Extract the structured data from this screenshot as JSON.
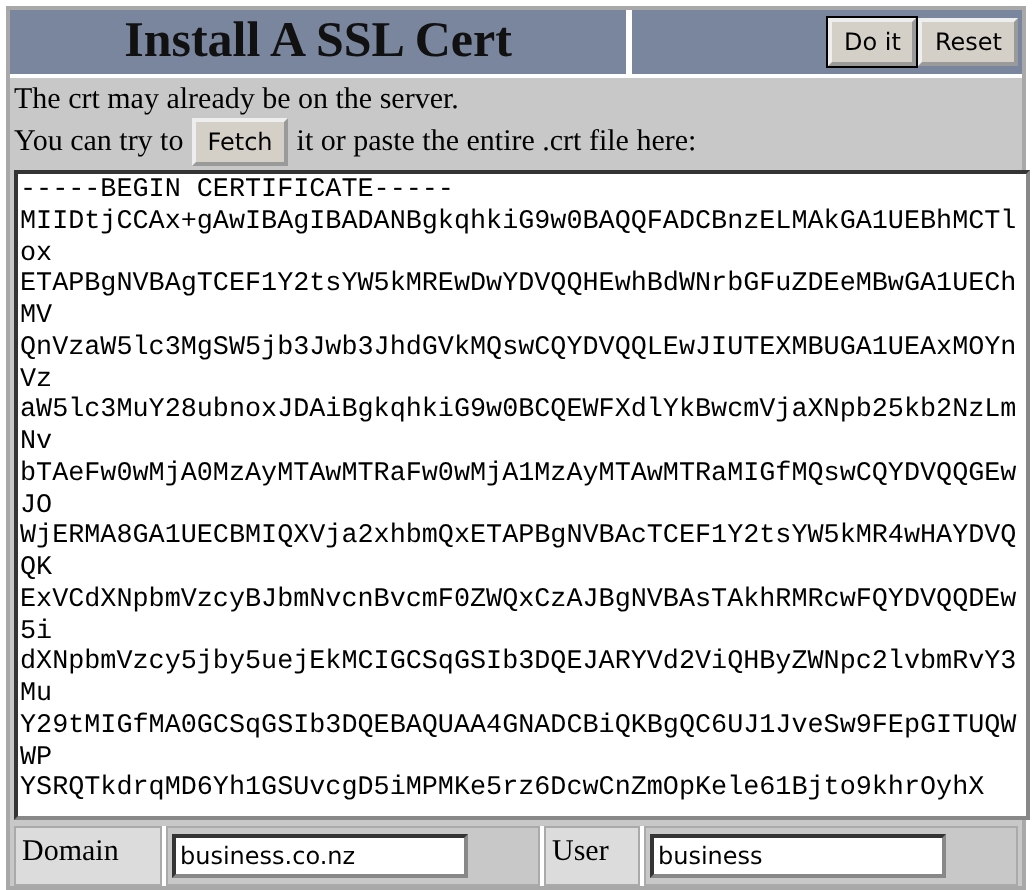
{
  "header": {
    "title": "Install A SSL Cert",
    "buttons": [
      "Do it",
      "Reset"
    ]
  },
  "intro": "The crt may already be on the server.",
  "fetch_line": {
    "before": "You can try to",
    "button": "Fetch",
    "after": "it or paste the entire .crt file here:"
  },
  "certificate": [
    "-----BEGIN CERTIFICATE-----",
    "MIIDtjCCAx+gAwIBAgIBADANBgkqhkiG9w0BAQQFADCBnzELMAkGA1UEBhMCTlox",
    "ETAPBgNVBAgTCEF1Y2tsYW5kMREwDwYDVQQHEwhBdWNrbGFuZDEeMBwGA1UEChMV",
    "QnVzaW5lc3MgSW5jb3Jwb3JhdGVkMQswCQYDVQQLEwJIUTEXMBUGA1UEAxMOYnVz",
    "aW5lc3MuY28ubnoxJDAiBgkqhkiG9w0BCQEWFXdlYkBwcmVjaXNpb25kb2NzLmNv",
    "bTAeFw0wMjA0MzAyMTAwMTRaFw0wMjA1MzAyMTAwMTRaMIGfMQswCQYDVQQGEwJO",
    "WjERMA8GA1UECBMIQXVja2xhbmQxETAPBgNVBAcTCEF1Y2tsYW5kMR4wHAYDVQQK",
    "ExVCdXNpbmVzcyBJbmNvcnBvcmF0ZWQxCzAJBgNVBAsTAkhRMRcwFQYDVQQDEw5i",
    "dXNpbmVzcy5jby5uejEkMCIGCSqGSIb3DQEJARYVd2ViQHByZWNpc2lvbmRvY3Mu",
    "Y29tMIGfMA0GCSqGSIb3DQEBAQUAA4GNADCBiQKBgQC6UJ1JveSw9FEpGITUQWWP",
    "YSRQTkdrqMD6Yh1GSUvcgD5iMPMKe5rz6DcwCnZmOpKele61Bjto9khrOyhX"
  ],
  "fields": [
    {
      "label": "Domain",
      "value": "business.co.nz"
    },
    {
      "label": "User",
      "value": "business"
    }
  ]
}
